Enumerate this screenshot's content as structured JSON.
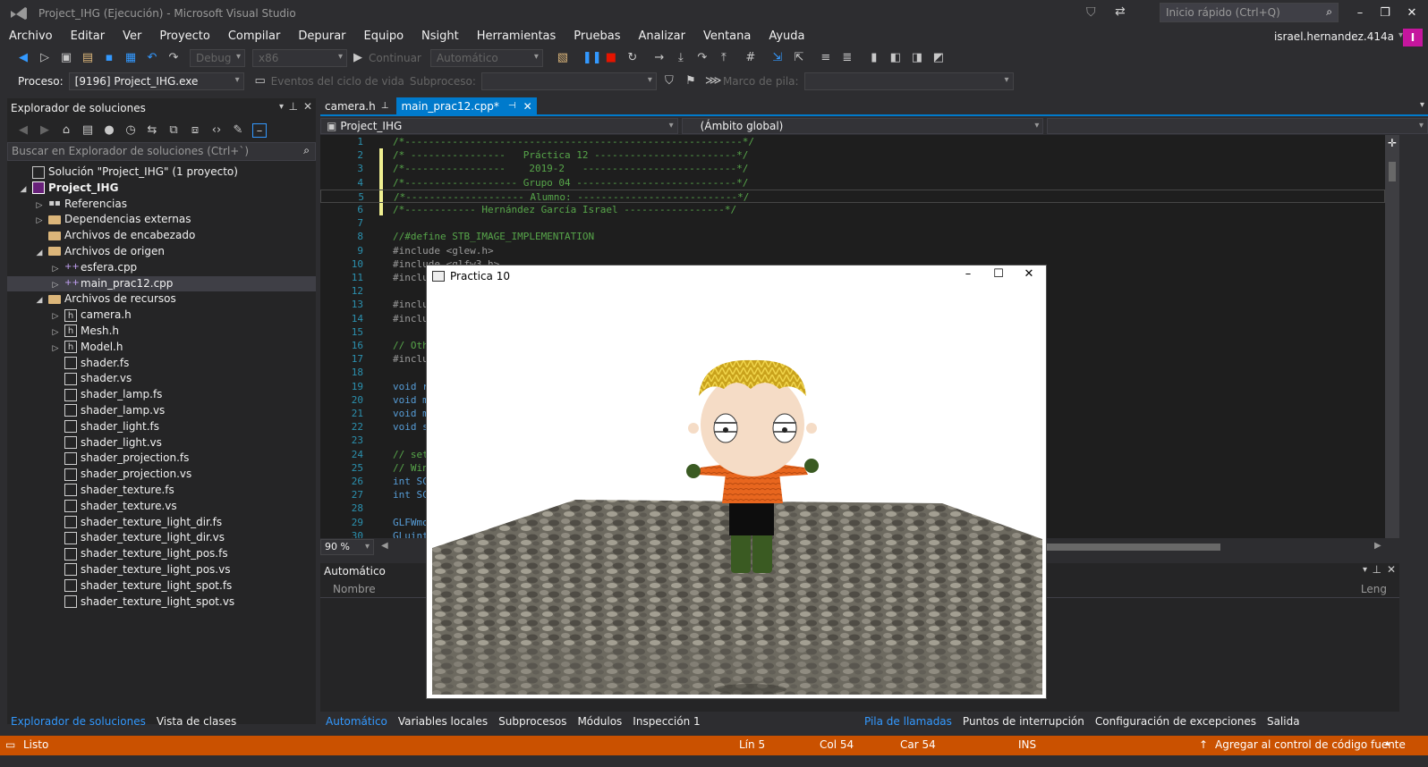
{
  "window": {
    "title": "Project_IHG (Ejecución) - Microsoft Visual Studio",
    "quick_launch": "Inicio rápido (Ctrl+Q)"
  },
  "menu": [
    "Archivo",
    "Editar",
    "Ver",
    "Proyecto",
    "Compilar",
    "Depurar",
    "Equipo",
    "Nsight",
    "Herramientas",
    "Pruebas",
    "Analizar",
    "Ventana",
    "Ayuda"
  ],
  "user": {
    "name": "israel.hernandez.414a",
    "avatar": "I"
  },
  "toolbar": {
    "config": "Debug",
    "platform": "x86",
    "continue": "Continuar",
    "auto": "Automático"
  },
  "debugbar": {
    "process_label": "Proceso:",
    "process": "[9196] Project_IHG.exe",
    "lifecycle": "Eventos del ciclo de vida",
    "thread_label": "Subproceso:",
    "stack_label": "Marco de pila:"
  },
  "solution_explorer": {
    "title": "Explorador de soluciones",
    "search": "Buscar en Explorador de soluciones (Ctrl+`)",
    "nodes": [
      {
        "label": "Solución \"Project_IHG\"  (1 proyecto)",
        "level": 0,
        "icon": "solution-icon",
        "arrow": ""
      },
      {
        "label": "Project_IHG",
        "level": 0,
        "icon": "project-icon",
        "arrow": "◢",
        "bold": true
      },
      {
        "label": "Referencias",
        "level": 1,
        "icon": "references-icon",
        "arrow": "▷"
      },
      {
        "label": "Dependencias externas",
        "level": 1,
        "icon": "folder-icon",
        "arrow": "▷"
      },
      {
        "label": "Archivos de encabezado",
        "level": 1,
        "icon": "folder-icon",
        "arrow": ""
      },
      {
        "label": "Archivos de origen",
        "level": 1,
        "icon": "folder-icon",
        "arrow": "◢"
      },
      {
        "label": "esfera.cpp",
        "level": 2,
        "icon": "cpp-file-icon",
        "arrow": "▷"
      },
      {
        "label": "main_prac12.cpp",
        "level": 2,
        "icon": "cpp-file-icon",
        "arrow": "▷",
        "selected": true
      },
      {
        "label": "Archivos de recursos",
        "level": 1,
        "icon": "folder-icon",
        "arrow": "◢"
      },
      {
        "label": "camera.h",
        "level": 2,
        "icon": "header-file-icon",
        "arrow": "▷"
      },
      {
        "label": "Mesh.h",
        "level": 2,
        "icon": "header-file-icon",
        "arrow": "▷"
      },
      {
        "label": "Model.h",
        "level": 2,
        "icon": "header-file-icon",
        "arrow": "▷"
      },
      {
        "label": "shader.fs",
        "level": 2,
        "icon": "shader-file-icon",
        "arrow": ""
      },
      {
        "label": "shader.vs",
        "level": 2,
        "icon": "shader-file-icon",
        "arrow": ""
      },
      {
        "label": "shader_lamp.fs",
        "level": 2,
        "icon": "shader-file-icon",
        "arrow": ""
      },
      {
        "label": "shader_lamp.vs",
        "level": 2,
        "icon": "shader-file-icon",
        "arrow": ""
      },
      {
        "label": "shader_light.fs",
        "level": 2,
        "icon": "shader-file-icon",
        "arrow": ""
      },
      {
        "label": "shader_light.vs",
        "level": 2,
        "icon": "shader-file-icon",
        "arrow": ""
      },
      {
        "label": "shader_projection.fs",
        "level": 2,
        "icon": "shader-file-icon",
        "arrow": ""
      },
      {
        "label": "shader_projection.vs",
        "level": 2,
        "icon": "shader-file-icon",
        "arrow": ""
      },
      {
        "label": "shader_texture.fs",
        "level": 2,
        "icon": "shader-file-icon",
        "arrow": ""
      },
      {
        "label": "shader_texture.vs",
        "level": 2,
        "icon": "shader-file-icon",
        "arrow": ""
      },
      {
        "label": "shader_texture_light_dir.fs",
        "level": 2,
        "icon": "shader-file-icon",
        "arrow": ""
      },
      {
        "label": "shader_texture_light_dir.vs",
        "level": 2,
        "icon": "shader-file-icon",
        "arrow": ""
      },
      {
        "label": "shader_texture_light_pos.fs",
        "level": 2,
        "icon": "shader-file-icon",
        "arrow": ""
      },
      {
        "label": "shader_texture_light_pos.vs",
        "level": 2,
        "icon": "shader-file-icon",
        "arrow": ""
      },
      {
        "label": "shader_texture_light_spot.fs",
        "level": 2,
        "icon": "shader-file-icon",
        "arrow": ""
      },
      {
        "label": "shader_texture_light_spot.vs",
        "level": 2,
        "icon": "shader-file-icon",
        "arrow": ""
      }
    ],
    "tabs": [
      "Explorador de soluciones",
      "Vista de clases"
    ]
  },
  "editor": {
    "tabs": [
      {
        "label": "camera.h",
        "active": false
      },
      {
        "label": "main_prac12.cpp*",
        "active": true
      }
    ],
    "nav_project": "Project_IHG",
    "nav_scope": "(Ámbito global)",
    "zoom": "90 %",
    "lines": [
      {
        "n": "1",
        "t": "/*---------------------------------------------------------*/",
        "c": "cmt"
      },
      {
        "n": "2",
        "t": "/* ----------------   Práctica 12 ------------------------*/",
        "c": "cmt"
      },
      {
        "n": "3",
        "t": "/*-----------------    2019-2   --------------------------*/",
        "c": "cmt"
      },
      {
        "n": "4",
        "t": "/*------------------- Grupo 04 ---------------------------*/",
        "c": "cmt"
      },
      {
        "n": "5",
        "t": "/*-------------------- Alumno: ---------------------------*/",
        "c": "cmt"
      },
      {
        "n": "6",
        "t": "/*------------ Hernández García Israel -----------------*/",
        "c": "cmt"
      },
      {
        "n": "7",
        "t": "",
        "c": "txt"
      },
      {
        "n": "8",
        "t": "//#define STB_IMAGE_IMPLEMENTATION",
        "c": "cmt"
      },
      {
        "n": "9",
        "t": "#include <glew.h>",
        "c": "inc"
      },
      {
        "n": "10",
        "t": "#include <glfw3.h>",
        "c": "inc"
      },
      {
        "n": "11",
        "t": "#inclu",
        "c": "inc"
      },
      {
        "n": "12",
        "t": "",
        "c": "txt"
      },
      {
        "n": "13",
        "t": "#inclu",
        "c": "inc"
      },
      {
        "n": "14",
        "t": "#inclu",
        "c": "inc"
      },
      {
        "n": "15",
        "t": "",
        "c": "txt"
      },
      {
        "n": "16",
        "t": "// Oth",
        "c": "cmt"
      },
      {
        "n": "17",
        "t": "#inclu",
        "c": "inc"
      },
      {
        "n": "18",
        "t": "",
        "c": "txt"
      },
      {
        "n": "19",
        "t": "void r",
        "c": "kw"
      },
      {
        "n": "20",
        "t": "void m",
        "c": "kw"
      },
      {
        "n": "21",
        "t": "void m",
        "c": "kw"
      },
      {
        "n": "22",
        "t": "void s",
        "c": "kw"
      },
      {
        "n": "23",
        "t": "",
        "c": "txt"
      },
      {
        "n": "24",
        "t": "// set",
        "c": "cmt"
      },
      {
        "n": "25",
        "t": "// Win",
        "c": "cmt"
      },
      {
        "n": "26",
        "t": "int SC",
        "c": "kw"
      },
      {
        "n": "27",
        "t": "int SC",
        "c": "kw"
      },
      {
        "n": "28",
        "t": "",
        "c": "txt"
      },
      {
        "n": "29",
        "t": "GLFWmo",
        "c": "kw"
      },
      {
        "n": "30",
        "t": "GLuint",
        "c": "kw"
      }
    ]
  },
  "auto_panel": {
    "title": "Automático",
    "col_name": "Nombre",
    "col_lang": "Leng"
  },
  "bottom_tabs_left": [
    "Automático",
    "Variables locales",
    "Subprocesos",
    "Módulos",
    "Inspección 1"
  ],
  "bottom_tabs_right": [
    "Pila de llamadas",
    "Puntos de interrupción",
    "Configuración de excepciones",
    "Salida"
  ],
  "status": {
    "ready": "Listo",
    "line": "Lín 5",
    "col": "Col 54",
    "char": "Car 54",
    "ins": "INS",
    "scm": "Agregar al control de código fuente"
  },
  "game_window": {
    "title": "Practica 10"
  },
  "colors": {
    "accent": "#007acc",
    "status": "#ca5100",
    "bg": "#2d2d30",
    "editor_bg": "#1e1e1e"
  }
}
